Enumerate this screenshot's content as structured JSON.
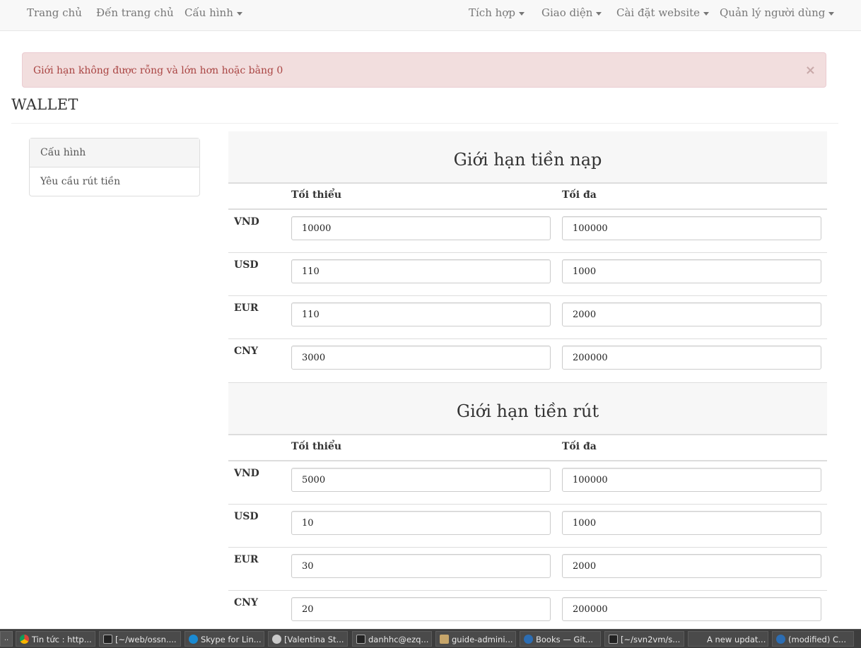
{
  "navbar": {
    "left": [
      {
        "label": "Trang chủ"
      },
      {
        "label": "Đến trang chủ"
      },
      {
        "label": "Cấu hình"
      }
    ],
    "right": [
      {
        "label": "Tích hợp"
      },
      {
        "label": "Giao diện"
      },
      {
        "label": "Cài đặt website"
      },
      {
        "label": "Quản lý người dùng"
      }
    ]
  },
  "alert": {
    "message": "Giới hạn không được rỗng và lớn hơn hoặc bằng 0",
    "close_label": "×"
  },
  "page": {
    "title": "WALLET"
  },
  "sidebar": {
    "items": [
      {
        "label": "Cấu hình"
      },
      {
        "label": "Yêu cầu rút tiền"
      }
    ]
  },
  "deposit": {
    "title": "Giới hạn tiền nạp",
    "min_header": "Tối thiểu",
    "max_header": "Tối đa",
    "rows": [
      {
        "currency": "VND",
        "min": "10000",
        "max": "100000"
      },
      {
        "currency": "USD",
        "min": "110",
        "max": "1000"
      },
      {
        "currency": "EUR",
        "min": "110",
        "max": "2000"
      },
      {
        "currency": "CNY",
        "min": "3000",
        "max": "200000"
      }
    ]
  },
  "withdraw": {
    "title": "Giới hạn tiền rút",
    "min_header": "Tối thiểu",
    "max_header": "Tối đa",
    "rows": [
      {
        "currency": "VND",
        "min": "5000",
        "max": "100000"
      },
      {
        "currency": "USD",
        "min": "10",
        "max": "1000"
      },
      {
        "currency": "EUR",
        "min": "30",
        "max": "2000"
      },
      {
        "currency": "CNY",
        "min": "20",
        "max": "200000"
      }
    ]
  },
  "taskbar": {
    "menu_label": "..",
    "items": [
      {
        "label": "Tin tức : http...",
        "icon": "chrome-icon"
      },
      {
        "label": "[~/web/ossn....",
        "icon": "terminal-icon"
      },
      {
        "label": "Skype for Lin...",
        "icon": "skype-icon"
      },
      {
        "label": "[Valentina St...",
        "icon": "app-icon"
      },
      {
        "label": "danhhc@ezq...",
        "icon": "terminal-icon"
      },
      {
        "label": "guide-admini...",
        "icon": "folder-icon"
      },
      {
        "label": "Books — Git...",
        "icon": "book-icon"
      },
      {
        "label": "[~/svn2vm/s...",
        "icon": "terminal-icon"
      },
      {
        "label": "A new updat...",
        "icon": ""
      },
      {
        "label": "(modified) C...",
        "icon": "book-icon"
      }
    ]
  },
  "colors": {
    "alert_bg": "#f2dede",
    "alert_text": "#a94442",
    "navbar_bg": "#f8f8f8",
    "section_bg": "#f7f7f7"
  }
}
